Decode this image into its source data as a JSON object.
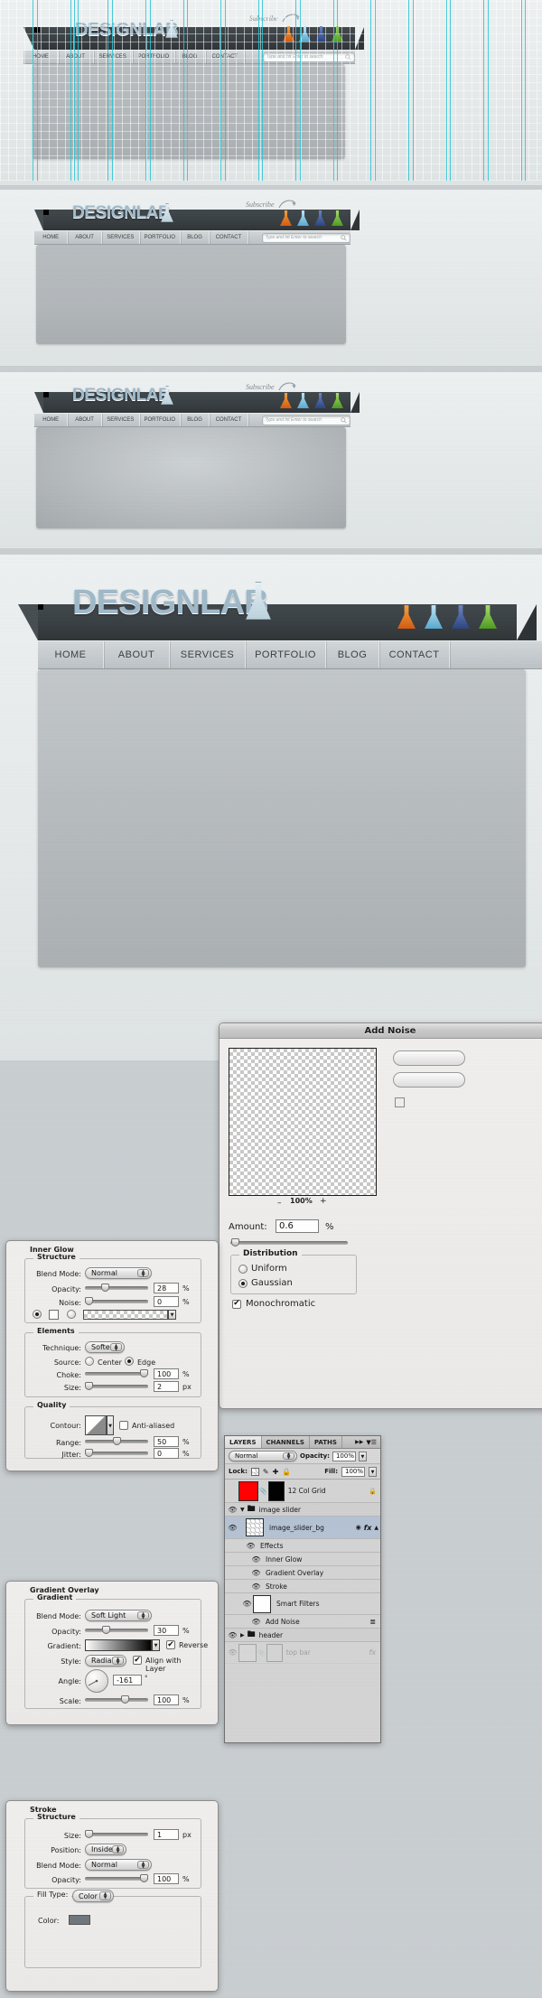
{
  "site": {
    "logo_text": "DESIGNLAB",
    "subscribe_label": "Subscribe",
    "nav": [
      {
        "label": "HOME"
      },
      {
        "label": "ABOUT"
      },
      {
        "label": "SERVICES"
      },
      {
        "label": "PORTFOLIO"
      },
      {
        "label": "BLOG"
      },
      {
        "label": "CONTACT"
      }
    ],
    "search_placeholder": "Type and hit Enter to search",
    "social": [
      {
        "name": "rss-flask-icon",
        "color": "#e8721c"
      },
      {
        "name": "twitter-flask-icon",
        "color": "#67c3e8"
      },
      {
        "name": "facebook-flask-icon",
        "color": "#3b5998"
      },
      {
        "name": "email-flask-icon",
        "color": "#6cbе33"
      }
    ],
    "guide_color": "#29c6d6"
  },
  "add_noise": {
    "title": "Add Noise",
    "zoom_level": "100%",
    "zoom_out": "–",
    "zoom_in": "+",
    "amount_label": "Amount:",
    "amount_value": "0.6",
    "amount_unit": "%",
    "distribution_legend": "Distribution",
    "uniform_label": "Uniform",
    "gaussian_label": "Gaussian",
    "distribution_selected": "Gaussian",
    "monochromatic_label": "Monochromatic",
    "monochromatic_checked": true
  },
  "inner_glow": {
    "title": "Inner Glow",
    "structure_legend": "Structure",
    "blend_mode_label": "Blend Mode:",
    "blend_mode_value": "Normal",
    "opacity_label": "Opacity:",
    "opacity_value": "28",
    "opacity_unit": "%",
    "noise_label": "Noise:",
    "noise_value": "0",
    "noise_unit": "%",
    "elements_legend": "Elements",
    "technique_label": "Technique:",
    "technique_value": "Softer",
    "source_label": "Source:",
    "source_center": "Center",
    "source_edge": "Edge",
    "source_selected": "Edge",
    "choke_label": "Choke:",
    "choke_value": "100",
    "choke_unit": "%",
    "size_label": "Size:",
    "size_value": "2",
    "size_unit": "px",
    "quality_legend": "Quality",
    "contour_label": "Contour:",
    "antialiased_label": "Anti-aliased",
    "antialiased_checked": false,
    "range_label": "Range:",
    "range_value": "50",
    "range_unit": "%",
    "jitter_label": "Jitter:",
    "jitter_value": "0",
    "jitter_unit": "%"
  },
  "gradient_overlay": {
    "title": "Gradient Overlay",
    "gradient_legend": "Gradient",
    "blend_mode_label": "Blend Mode:",
    "blend_mode_value": "Soft Light",
    "opacity_label": "Opacity:",
    "opacity_value": "30",
    "opacity_unit": "%",
    "gradient_label": "Gradient:",
    "reverse_label": "Reverse",
    "reverse_checked": true,
    "style_label": "Style:",
    "style_value": "Radial",
    "align_label": "Align with Layer",
    "align_checked": true,
    "angle_label": "Angle:",
    "angle_value": "-161",
    "angle_unit": "°",
    "scale_label": "Scale:",
    "scale_value": "100",
    "scale_unit": "%"
  },
  "stroke": {
    "title": "Stroke",
    "structure_legend": "Structure",
    "size_label": "Size:",
    "size_value": "1",
    "size_unit": "px",
    "position_label": "Position:",
    "position_value": "Inside",
    "blend_mode_label": "Blend Mode:",
    "blend_mode_value": "Normal",
    "opacity_label": "Opacity:",
    "opacity_value": "100",
    "opacity_unit": "%",
    "fill_type_label": "Fill Type:",
    "fill_type_value": "Color",
    "color_label": "Color:",
    "color_value": "#6f767c"
  },
  "layers_panel": {
    "tabs": [
      "LAYERS",
      "CHANNELS",
      "PATHS"
    ],
    "active_tab": "LAYERS",
    "blend_mode": "Normal",
    "opacity_label": "Opacity:",
    "opacity_value": "100%",
    "lock_label": "Lock:",
    "fill_label": "Fill:",
    "fill_value": "100%",
    "rows": [
      {
        "name": "12 Col Grid",
        "kind": "layer",
        "visible": false,
        "locked": true
      },
      {
        "name": "image slider",
        "kind": "group",
        "visible": true,
        "expanded": true
      },
      {
        "name": "image_slider_bg",
        "kind": "layer",
        "visible": true,
        "selected": true,
        "has_fx": true
      },
      {
        "name": "Effects",
        "kind": "effects",
        "visible": true
      },
      {
        "name": "Inner Glow",
        "kind": "effect",
        "visible": true
      },
      {
        "name": "Gradient Overlay",
        "kind": "effect",
        "visible": true
      },
      {
        "name": "Stroke",
        "kind": "effect",
        "visible": true
      },
      {
        "name": "Smart Filters",
        "kind": "smart",
        "visible": true
      },
      {
        "name": "Add Noise",
        "kind": "filter",
        "visible": true
      },
      {
        "name": "header",
        "kind": "group",
        "visible": true,
        "expanded": false
      },
      {
        "name": "top bar",
        "kind": "layer",
        "visible": false,
        "faded": true
      }
    ]
  }
}
